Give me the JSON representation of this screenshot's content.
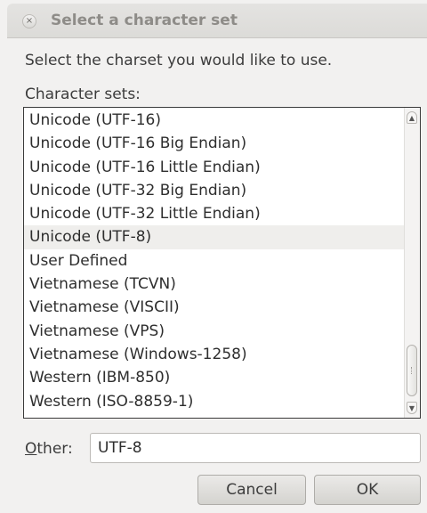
{
  "window": {
    "title": "Select a character set",
    "close_symbol": "×"
  },
  "dialog": {
    "prompt": "Select the charset you would like to use.",
    "list_label": "Character sets:",
    "items": [
      "Unicode (UTF-16)",
      "Unicode (UTF-16 Big Endian)",
      "Unicode (UTF-16 Little Endian)",
      "Unicode (UTF-32 Big Endian)",
      "Unicode (UTF-32 Little Endian)",
      "Unicode (UTF-8)",
      "User Defined",
      "Vietnamese (TCVN)",
      "Vietnamese (VISCII)",
      "Vietnamese (VPS)",
      "Vietnamese (Windows-1258)",
      "Western (IBM-850)",
      "Western (ISO-8859-1)"
    ],
    "selected_item": "Unicode (UTF-8)",
    "other_label_mnemonic": "O",
    "other_label_rest": "ther:",
    "other_value": "UTF-8"
  },
  "buttons": {
    "cancel_label": "Cancel",
    "ok_label": "OK"
  },
  "icons": {
    "close": "close-icon",
    "scroll_up": "chevron-up-icon",
    "scroll_down": "chevron-down-icon",
    "scroll_thumb": "scroll-thumb"
  },
  "colors": {
    "background": "#f2f1f0",
    "selected_row": "#efeeec",
    "title_text": "#8e8c88"
  }
}
